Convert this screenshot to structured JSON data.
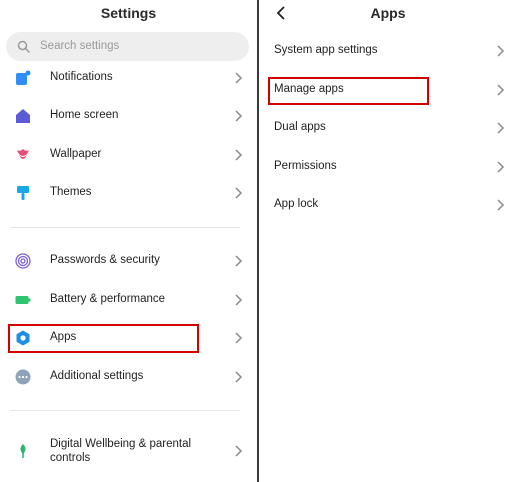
{
  "left": {
    "title": "Settings",
    "search_placeholder": "Search settings",
    "items": [
      {
        "label": "Notifications",
        "icon": "notification-icon",
        "color": "#2f8df5"
      },
      {
        "label": "Home screen",
        "icon": "home-icon",
        "color": "#5b5bd6"
      },
      {
        "label": "Wallpaper",
        "icon": "tulip-icon",
        "color": "#ea4d7a"
      },
      {
        "label": "Themes",
        "icon": "brush-icon",
        "color": "#1aa7e5"
      },
      {
        "label": "Passwords & security",
        "icon": "fingerprint-icon",
        "color": "#7b5fd6"
      },
      {
        "label": "Battery & performance",
        "icon": "battery-icon",
        "color": "#2fc46f"
      },
      {
        "label": "Apps",
        "icon": "gear-icon",
        "color": "#1e8fe6"
      },
      {
        "label": "Additional settings",
        "icon": "more-icon",
        "color": "#8fa3b8"
      },
      {
        "label": "Digital Wellbeing & parental",
        "label2": "controls",
        "icon": "wellbeing-icon",
        "color": "#2bb673"
      }
    ]
  },
  "right": {
    "title": "Apps",
    "items": [
      {
        "label": "System app settings"
      },
      {
        "label": "Manage apps"
      },
      {
        "label": "Dual apps"
      },
      {
        "label": "Permissions"
      },
      {
        "label": "App lock"
      }
    ]
  },
  "colors": {
    "highlight": "#d40000",
    "chevron": "#8a8a8a"
  }
}
